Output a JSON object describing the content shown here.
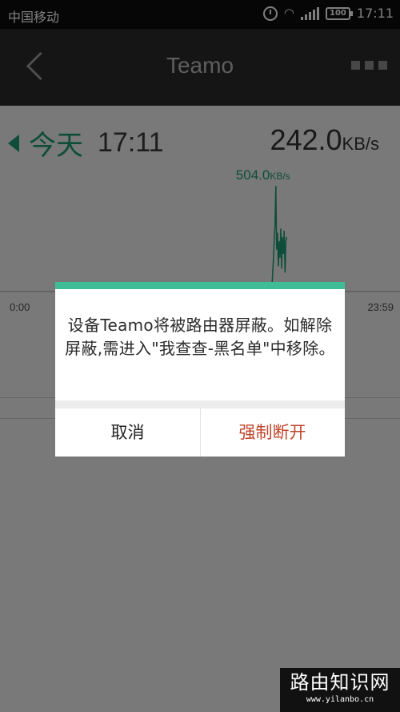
{
  "status_bar": {
    "carrier": "中国移动",
    "battery": "100",
    "time": "17:11",
    "icons": [
      "alarm-icon",
      "wifi-icon",
      "signal-icon",
      "battery-icon"
    ]
  },
  "nav": {
    "title": "Teamo",
    "back_icon": "chevron-left-icon",
    "more_icon": "more-icon"
  },
  "summary": {
    "date_label": "今天",
    "time": "17:11",
    "total_speed": "242.0",
    "total_speed_unit": "KB/s"
  },
  "chart": {
    "peak_value": "504.0",
    "peak_unit": "KB/s",
    "axis_start": "0:00",
    "axis_end": "23:59",
    "line_color": "#1a9b72"
  },
  "chart_data": {
    "type": "line",
    "xlabel": "",
    "ylabel": "",
    "x": [
      16.3,
      16.4,
      16.5,
      16.55,
      16.6,
      16.65,
      16.7,
      16.75,
      16.8,
      16.85,
      16.9,
      16.95,
      17.0,
      17.05,
      17.1,
      17.15,
      17.2
    ],
    "values": [
      0,
      150,
      320,
      504,
      200,
      280,
      120,
      240,
      160,
      300,
      110,
      260,
      180,
      290,
      90,
      240,
      260
    ],
    "xlim": [
      "0:00",
      "23:59"
    ],
    "annotations": [
      {
        "text": "504.0KB/s",
        "label": "peak"
      }
    ]
  },
  "dialog": {
    "message": "设备Teamo将被路由器屏蔽。如解除屏蔽,需进入\"我查查-黑名单\"中移除。",
    "cancel_label": "取消",
    "confirm_label": "强制断开",
    "accent_color": "#3fbd96",
    "confirm_color": "#c0452a"
  },
  "watermark": {
    "title": "路由知识网",
    "url": "www.yilanbo.cn"
  }
}
